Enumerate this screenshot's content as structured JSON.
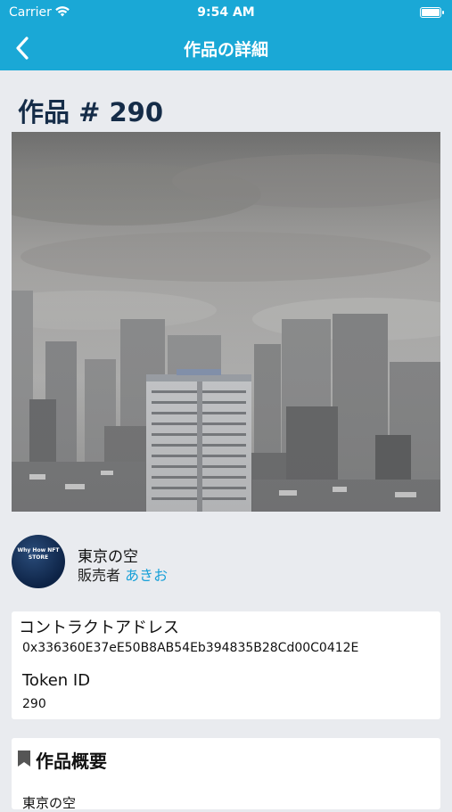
{
  "status": {
    "carrier": "Carrier",
    "time": "9:54 AM"
  },
  "nav": {
    "title": "作品の詳細"
  },
  "work": {
    "title": "作品 # 290",
    "name": "東京の空",
    "seller_label": "販売者",
    "seller_name": "あきお",
    "avatar_text": "Why How NFT STORE"
  },
  "contract": {
    "address_label": "コントラクトアドレス",
    "address_value": "0x336360E37eE50B8AB54Eb394835B28Cd00C0412E",
    "token_label": "Token ID",
    "token_value": "290"
  },
  "summary": {
    "heading": "作品概要",
    "body": "東京の空"
  }
}
